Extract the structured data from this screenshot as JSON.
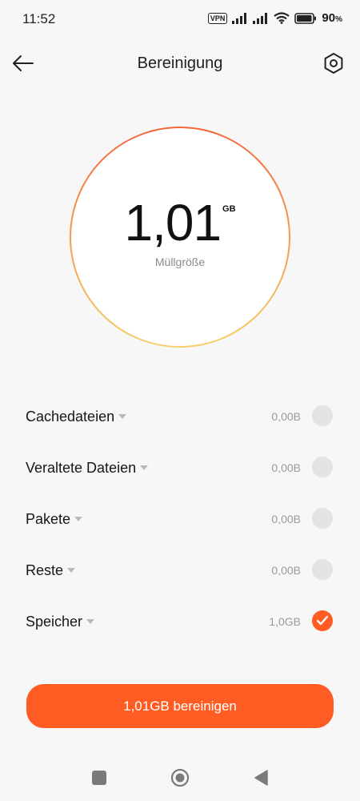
{
  "status_bar": {
    "time": "11:52",
    "vpn": "VPN",
    "battery": "90",
    "battery_suffix": "%",
    "icons": [
      "vpn-icon",
      "signal-icon",
      "signal-icon",
      "wifi-icon",
      "battery-icon"
    ]
  },
  "header": {
    "title": "Bereinigung",
    "back_icon": "arrow-left-icon",
    "settings_icon": "hexagon-settings-icon"
  },
  "summary": {
    "value": "1,01",
    "unit": "GB",
    "caption": "Müllgröße"
  },
  "items": [
    {
      "label": "Cachedateien",
      "size": "0,00B",
      "checked": false
    },
    {
      "label": "Veraltete Dateien",
      "size": "0,00B",
      "checked": false
    },
    {
      "label": "Pakete",
      "size": "0,00B",
      "checked": false
    },
    {
      "label": "Reste",
      "size": "0,00B",
      "checked": false
    },
    {
      "label": "Speicher",
      "size": "1,0GB",
      "checked": true
    }
  ],
  "action": {
    "label": "1,01GB bereinigen"
  },
  "colors": {
    "accent": "#ff5c23",
    "ring_start": "#f4663a",
    "ring_end": "#f7cf6a",
    "unchecked": "#e3e3e3",
    "background": "#f7f7f7"
  },
  "nav": {
    "icons": [
      "square-recent-icon",
      "circle-home-icon",
      "triangle-back-icon"
    ]
  }
}
